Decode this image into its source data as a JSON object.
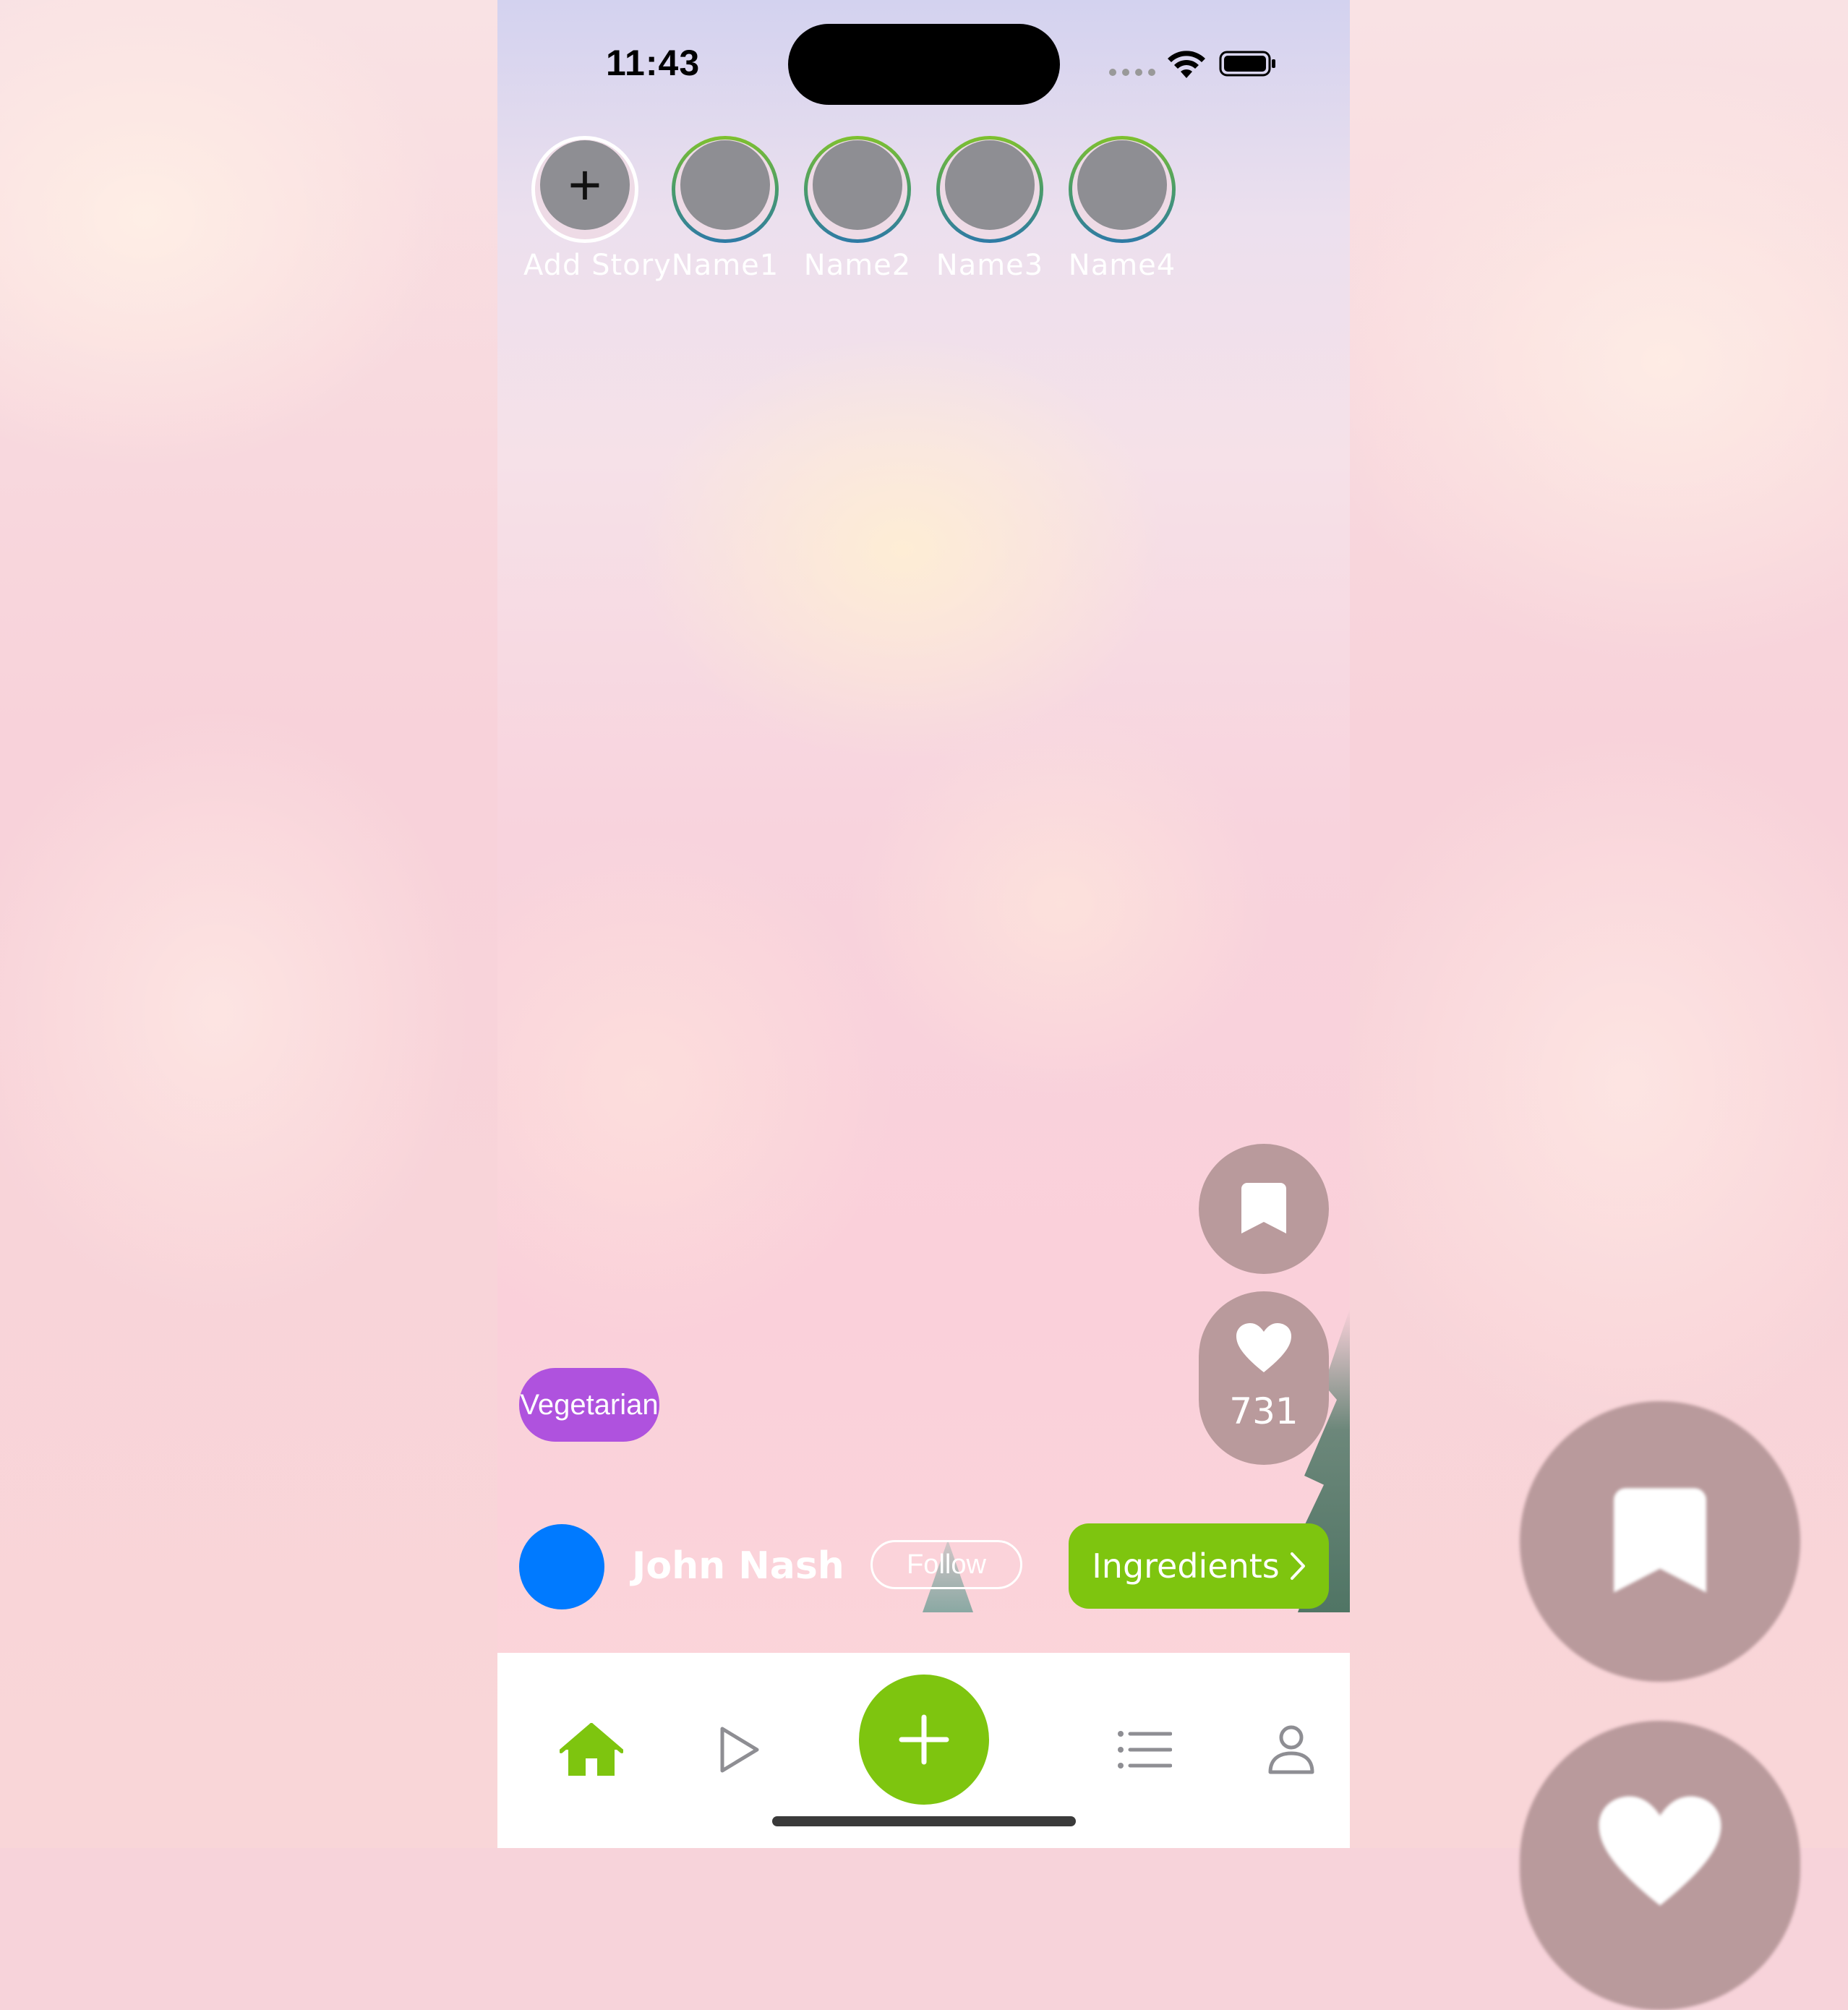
{
  "status_bar": {
    "time": "11:43"
  },
  "stories": {
    "items": [
      {
        "label": "Add Story",
        "type": "add"
      },
      {
        "label": "Name1",
        "type": "user"
      },
      {
        "label": "Name2",
        "type": "user"
      },
      {
        "label": "Name3",
        "type": "user"
      },
      {
        "label": "Name4",
        "type": "user"
      }
    ]
  },
  "post": {
    "tag": "Vegetarian",
    "likes": "731",
    "author": {
      "name": "John Nash"
    },
    "follow_label": "Follow",
    "ingredients_label": "Ingredients"
  },
  "tabbar": {
    "items": [
      {
        "icon": "home-icon",
        "active": true
      },
      {
        "icon": "play-icon",
        "active": false
      },
      {
        "icon": "plus-icon",
        "active": false
      },
      {
        "icon": "list-icon",
        "active": false
      },
      {
        "icon": "profile-icon",
        "active": false
      }
    ]
  },
  "colors": {
    "accent": "#7ec50f",
    "tag": "#af52de",
    "author_avatar": "#007aff",
    "action_button": "#b99a9c",
    "story_avatar": "#8e8e93"
  }
}
